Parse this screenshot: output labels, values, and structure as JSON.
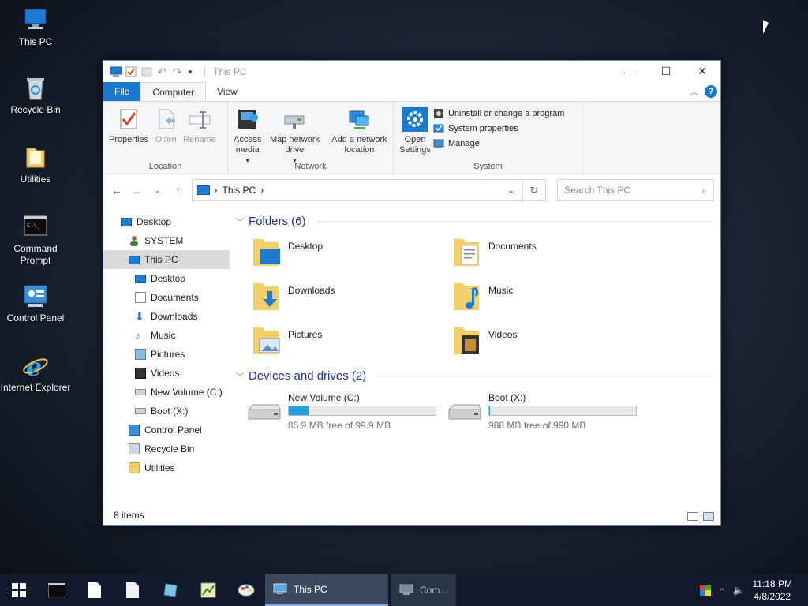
{
  "desktop": {
    "icons": [
      {
        "label": "This PC"
      },
      {
        "label": "Recycle Bin"
      },
      {
        "label": "Utilities"
      },
      {
        "label": "Command Prompt"
      },
      {
        "label": "Control Panel"
      },
      {
        "label": "Internet Explorer"
      }
    ]
  },
  "window": {
    "title": "This PC",
    "tabs": {
      "file": "File",
      "computer": "Computer",
      "view": "View"
    },
    "help": "?",
    "ribbon": {
      "location": {
        "name": "Location",
        "properties": "Properties",
        "open": "Open",
        "rename": "Rename"
      },
      "network": {
        "name": "Network",
        "access_media": "Access media",
        "map_drive": "Map network drive",
        "add_location": "Add a network location"
      },
      "system": {
        "name": "System",
        "open_settings": "Open Settings",
        "uninstall": "Uninstall or change a program",
        "system_properties": "System properties",
        "manage": "Manage"
      }
    },
    "address": {
      "path": "This PC",
      "separator": "›"
    },
    "search": {
      "placeholder": "Search This PC"
    },
    "nav": [
      {
        "label": "Desktop"
      },
      {
        "label": "SYSTEM"
      },
      {
        "label": "This PC"
      },
      {
        "label": "Desktop"
      },
      {
        "label": "Documents"
      },
      {
        "label": "Downloads"
      },
      {
        "label": "Music"
      },
      {
        "label": "Pictures"
      },
      {
        "label": "Videos"
      },
      {
        "label": "New Volume (C:)"
      },
      {
        "label": "Boot (X:)"
      },
      {
        "label": "Control Panel"
      },
      {
        "label": "Recycle Bin"
      },
      {
        "label": "Utilities"
      }
    ],
    "folders_header": "Folders (6)",
    "folders": [
      {
        "label": "Desktop"
      },
      {
        "label": "Documents"
      },
      {
        "label": "Downloads"
      },
      {
        "label": "Music"
      },
      {
        "label": "Pictures"
      },
      {
        "label": "Videos"
      }
    ],
    "drives_header": "Devices and drives (2)",
    "drives": [
      {
        "label": "New Volume (C:)",
        "free_text": "85.9 MB free of 99.9 MB",
        "used_fraction": 0.14
      },
      {
        "label": "Boot (X:)",
        "free_text": "988 MB free of 990 MB",
        "used_fraction": 0.002
      }
    ],
    "status": "8 items"
  },
  "taskbar": {
    "tasks": [
      {
        "label": "This PC"
      },
      {
        "label": "Com..."
      }
    ],
    "clock": {
      "time": "11:18 PM",
      "date": "4/8/2022"
    }
  },
  "colors": {
    "accent": "#1979ca",
    "drive_bar": "#26a0da",
    "taskbar": "#101a2b"
  }
}
